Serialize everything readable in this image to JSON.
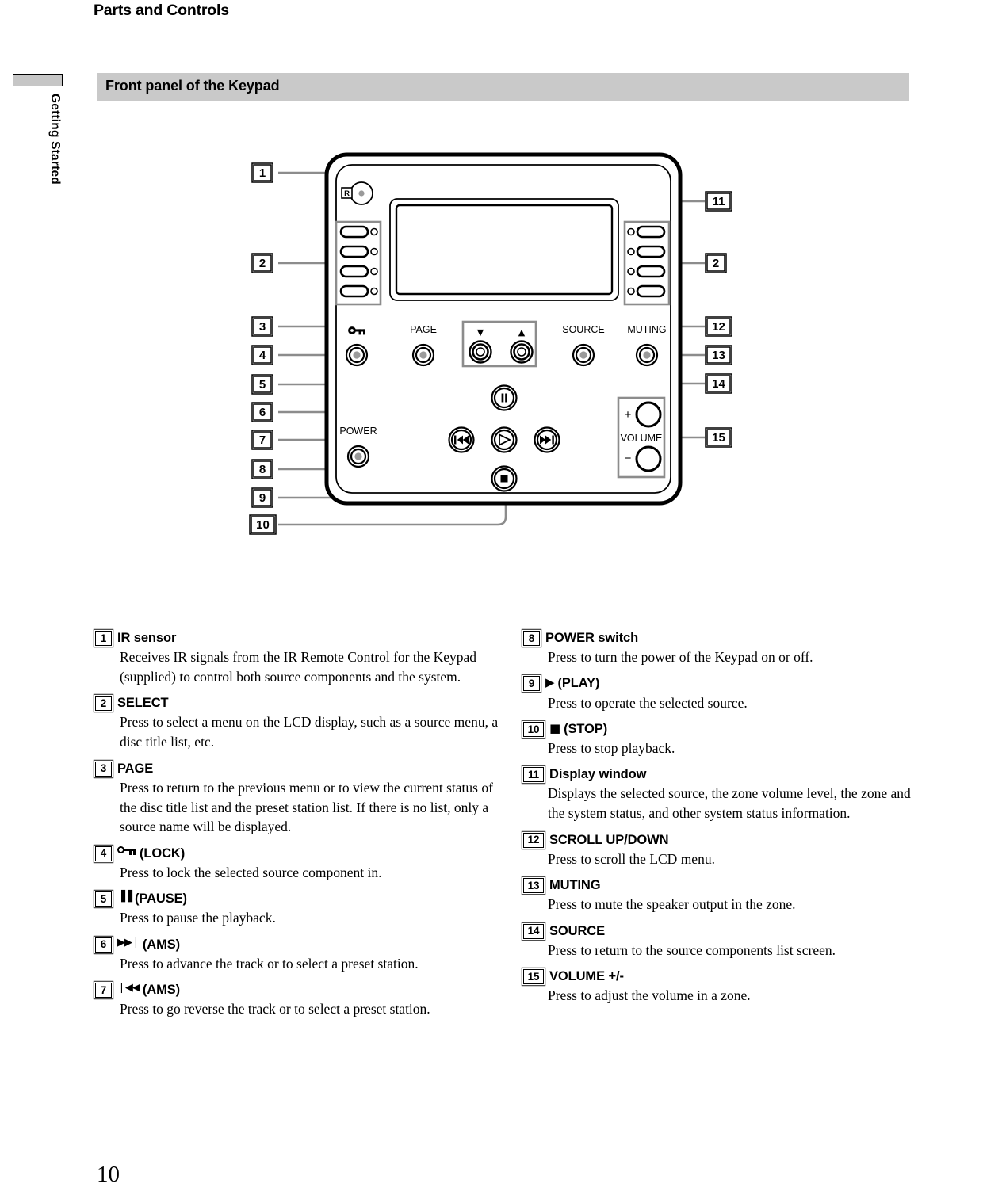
{
  "page": {
    "title": "Parts and Controls",
    "side_tab": "Getting Started",
    "section_heading": "Front panel of the Keypad",
    "page_number": "10"
  },
  "figure": {
    "caption_labels": {
      "page": "PAGE",
      "source": "SOURCE",
      "muting": "MUTING",
      "power": "POWER",
      "volume": "VOLUME",
      "volume_plus": "+",
      "volume_minus": "−",
      "scroll_down": "▼",
      "scroll_up": "▲",
      "ir_mark": "R"
    },
    "callouts_left": [
      "1",
      "2",
      "3",
      "4",
      "5",
      "6",
      "7",
      "8",
      "9",
      "10"
    ],
    "callouts_right": [
      "11",
      "2",
      "12",
      "13",
      "14",
      "15"
    ]
  },
  "descriptions": {
    "left": [
      {
        "num": "1",
        "glyph": "",
        "title": "IR sensor",
        "body": "Receives IR signals from the IR Remote Control for the Keypad (supplied) to control both source components and the system."
      },
      {
        "num": "2",
        "glyph": "",
        "title": "SELECT",
        "body": "Press to select a menu on the LCD display, such as a source menu, a disc title list, etc."
      },
      {
        "num": "3",
        "glyph": "",
        "title": "PAGE",
        "body": "Press to return to the previous menu or to view the current status of the disc title list and the preset station list. If there is no list, only a source name will be displayed."
      },
      {
        "num": "4",
        "glyph": "lock-key-icon",
        "title": "(LOCK)",
        "body": "Press to lock the selected source component in."
      },
      {
        "num": "5",
        "glyph": "▐▐",
        "title": "(PAUSE)",
        "body": "Press to pause the playback."
      },
      {
        "num": "6",
        "glyph": "▶▶❘",
        "title": "(AMS)",
        "body": "Press to advance the track or to select a preset station."
      },
      {
        "num": "7",
        "glyph": "❘◀◀",
        "title": "(AMS)",
        "body": "Press to go reverse the track or to select a preset station."
      }
    ],
    "right": [
      {
        "num": "8",
        "glyph": "",
        "title": "POWER switch",
        "body": "Press to turn the power of the Keypad on or off."
      },
      {
        "num": "9",
        "glyph": "▶",
        "title": "(PLAY)",
        "body": "Press to operate the selected source."
      },
      {
        "num": "10",
        "glyph": "■",
        "title": "(STOP)",
        "body": "Press to stop playback."
      },
      {
        "num": "11",
        "glyph": "",
        "title": "Display window",
        "body": "Displays the selected source, the zone volume level, the zone and the system status, and other system status information."
      },
      {
        "num": "12",
        "glyph": "",
        "title": "SCROLL UP/DOWN",
        "body": "Press to scroll the LCD menu."
      },
      {
        "num": "13",
        "glyph": "",
        "title": "MUTING",
        "body": "Press to mute the speaker output in the zone."
      },
      {
        "num": "14",
        "glyph": "",
        "title": "SOURCE",
        "body": "Press to return to the source components list screen."
      },
      {
        "num": "15",
        "glyph": "",
        "title": "VOLUME +/-",
        "body": "Press to adjust the volume in a zone."
      }
    ]
  },
  "colors": {
    "band": "#c9c9c9",
    "leader": "#8c8c8c",
    "outline": "#000000"
  }
}
